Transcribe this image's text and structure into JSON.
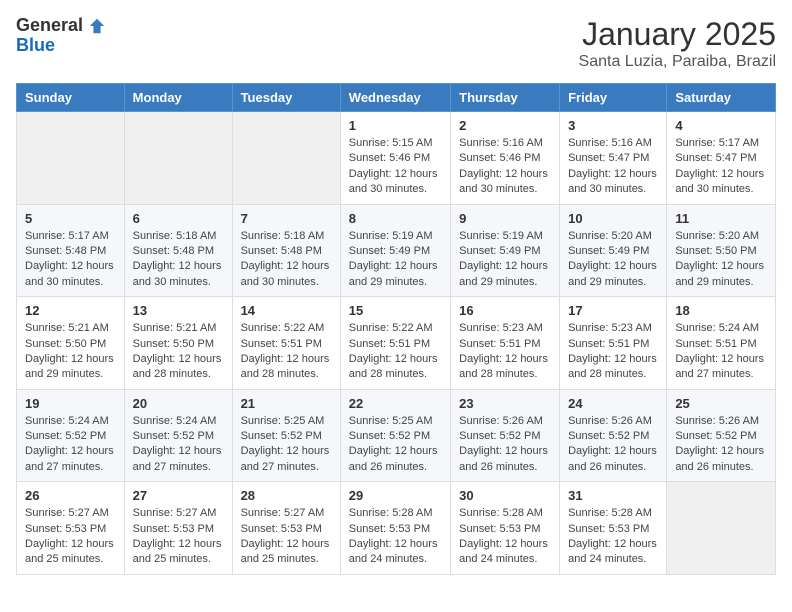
{
  "logo": {
    "line1": "General",
    "line2": "Blue"
  },
  "header": {
    "month": "January 2025",
    "location": "Santa Luzia, Paraiba, Brazil"
  },
  "weekdays": [
    "Sunday",
    "Monday",
    "Tuesday",
    "Wednesday",
    "Thursday",
    "Friday",
    "Saturday"
  ],
  "weeks": [
    [
      {
        "day": "",
        "info": ""
      },
      {
        "day": "",
        "info": ""
      },
      {
        "day": "",
        "info": ""
      },
      {
        "day": "1",
        "info": "Sunrise: 5:15 AM\nSunset: 5:46 PM\nDaylight: 12 hours\nand 30 minutes."
      },
      {
        "day": "2",
        "info": "Sunrise: 5:16 AM\nSunset: 5:46 PM\nDaylight: 12 hours\nand 30 minutes."
      },
      {
        "day": "3",
        "info": "Sunrise: 5:16 AM\nSunset: 5:47 PM\nDaylight: 12 hours\nand 30 minutes."
      },
      {
        "day": "4",
        "info": "Sunrise: 5:17 AM\nSunset: 5:47 PM\nDaylight: 12 hours\nand 30 minutes."
      }
    ],
    [
      {
        "day": "5",
        "info": "Sunrise: 5:17 AM\nSunset: 5:48 PM\nDaylight: 12 hours\nand 30 minutes."
      },
      {
        "day": "6",
        "info": "Sunrise: 5:18 AM\nSunset: 5:48 PM\nDaylight: 12 hours\nand 30 minutes."
      },
      {
        "day": "7",
        "info": "Sunrise: 5:18 AM\nSunset: 5:48 PM\nDaylight: 12 hours\nand 30 minutes."
      },
      {
        "day": "8",
        "info": "Sunrise: 5:19 AM\nSunset: 5:49 PM\nDaylight: 12 hours\nand 29 minutes."
      },
      {
        "day": "9",
        "info": "Sunrise: 5:19 AM\nSunset: 5:49 PM\nDaylight: 12 hours\nand 29 minutes."
      },
      {
        "day": "10",
        "info": "Sunrise: 5:20 AM\nSunset: 5:49 PM\nDaylight: 12 hours\nand 29 minutes."
      },
      {
        "day": "11",
        "info": "Sunrise: 5:20 AM\nSunset: 5:50 PM\nDaylight: 12 hours\nand 29 minutes."
      }
    ],
    [
      {
        "day": "12",
        "info": "Sunrise: 5:21 AM\nSunset: 5:50 PM\nDaylight: 12 hours\nand 29 minutes."
      },
      {
        "day": "13",
        "info": "Sunrise: 5:21 AM\nSunset: 5:50 PM\nDaylight: 12 hours\nand 28 minutes."
      },
      {
        "day": "14",
        "info": "Sunrise: 5:22 AM\nSunset: 5:51 PM\nDaylight: 12 hours\nand 28 minutes."
      },
      {
        "day": "15",
        "info": "Sunrise: 5:22 AM\nSunset: 5:51 PM\nDaylight: 12 hours\nand 28 minutes."
      },
      {
        "day": "16",
        "info": "Sunrise: 5:23 AM\nSunset: 5:51 PM\nDaylight: 12 hours\nand 28 minutes."
      },
      {
        "day": "17",
        "info": "Sunrise: 5:23 AM\nSunset: 5:51 PM\nDaylight: 12 hours\nand 28 minutes."
      },
      {
        "day": "18",
        "info": "Sunrise: 5:24 AM\nSunset: 5:51 PM\nDaylight: 12 hours\nand 27 minutes."
      }
    ],
    [
      {
        "day": "19",
        "info": "Sunrise: 5:24 AM\nSunset: 5:52 PM\nDaylight: 12 hours\nand 27 minutes."
      },
      {
        "day": "20",
        "info": "Sunrise: 5:24 AM\nSunset: 5:52 PM\nDaylight: 12 hours\nand 27 minutes."
      },
      {
        "day": "21",
        "info": "Sunrise: 5:25 AM\nSunset: 5:52 PM\nDaylight: 12 hours\nand 27 minutes."
      },
      {
        "day": "22",
        "info": "Sunrise: 5:25 AM\nSunset: 5:52 PM\nDaylight: 12 hours\nand 26 minutes."
      },
      {
        "day": "23",
        "info": "Sunrise: 5:26 AM\nSunset: 5:52 PM\nDaylight: 12 hours\nand 26 minutes."
      },
      {
        "day": "24",
        "info": "Sunrise: 5:26 AM\nSunset: 5:52 PM\nDaylight: 12 hours\nand 26 minutes."
      },
      {
        "day": "25",
        "info": "Sunrise: 5:26 AM\nSunset: 5:52 PM\nDaylight: 12 hours\nand 26 minutes."
      }
    ],
    [
      {
        "day": "26",
        "info": "Sunrise: 5:27 AM\nSunset: 5:53 PM\nDaylight: 12 hours\nand 25 minutes."
      },
      {
        "day": "27",
        "info": "Sunrise: 5:27 AM\nSunset: 5:53 PM\nDaylight: 12 hours\nand 25 minutes."
      },
      {
        "day": "28",
        "info": "Sunrise: 5:27 AM\nSunset: 5:53 PM\nDaylight: 12 hours\nand 25 minutes."
      },
      {
        "day": "29",
        "info": "Sunrise: 5:28 AM\nSunset: 5:53 PM\nDaylight: 12 hours\nand 24 minutes."
      },
      {
        "day": "30",
        "info": "Sunrise: 5:28 AM\nSunset: 5:53 PM\nDaylight: 12 hours\nand 24 minutes."
      },
      {
        "day": "31",
        "info": "Sunrise: 5:28 AM\nSunset: 5:53 PM\nDaylight: 12 hours\nand 24 minutes."
      },
      {
        "day": "",
        "info": ""
      }
    ]
  ]
}
